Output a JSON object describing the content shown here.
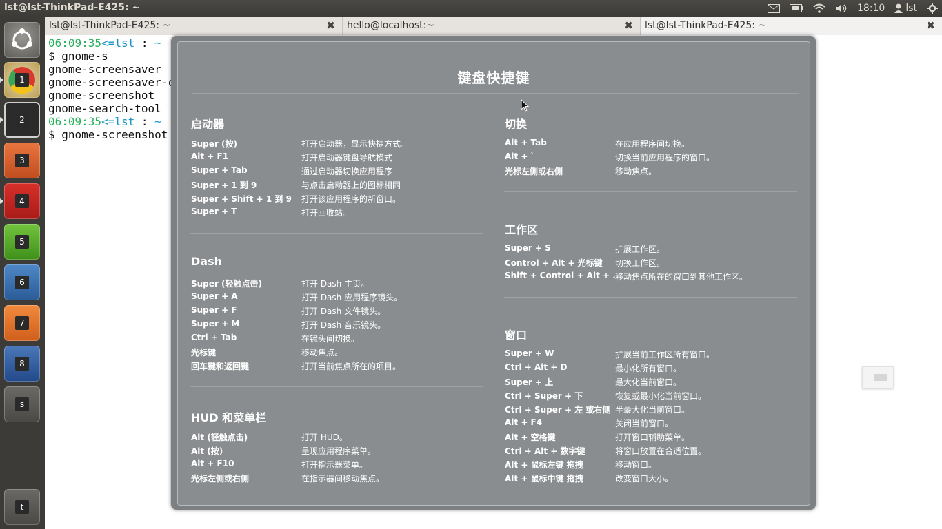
{
  "panel": {
    "title": "lst@lst-ThinkPad-E425: ~",
    "time": "18:10",
    "user": "lst"
  },
  "launcher": {
    "items": [
      {
        "name": "dash-home-icon",
        "number": ""
      },
      {
        "name": "chrome-icon",
        "number": "1"
      },
      {
        "name": "terminal-icon",
        "number": "2"
      },
      {
        "name": "files-icon",
        "number": "3"
      },
      {
        "name": "filezilla-icon",
        "number": "4"
      },
      {
        "name": "app-green-icon",
        "number": "5"
      },
      {
        "name": "thunderbird-icon",
        "number": "6"
      },
      {
        "name": "system-settings-icon",
        "number": "7"
      },
      {
        "name": "virtualbox-icon",
        "number": "8"
      },
      {
        "name": "workspace-switcher-icon",
        "number": "s"
      },
      {
        "name": "trash-icon",
        "number": "t"
      }
    ]
  },
  "tabs": [
    {
      "label": "lst@lst-ThinkPad-E425: ~"
    },
    {
      "label": "hello@localhost:~"
    },
    {
      "label": "lst@lst-ThinkPad-E425: ~"
    }
  ],
  "terminal": {
    "lines": [
      {
        "time": "06:09:35",
        "prompt": "<=lst",
        "sep": " : ",
        "dir": "~"
      },
      {
        "text": "$ gnome-s"
      },
      {
        "text": "gnome-screensaver"
      },
      {
        "text": "gnome-screensaver-command"
      },
      {
        "text": "gnome-screenshot"
      },
      {
        "text": "gnome-search-tool"
      },
      {
        "time": "06:09:35",
        "prompt": "<=lst",
        "sep": " : ",
        "dir": "~"
      },
      {
        "text": "$ gnome-screenshot"
      }
    ]
  },
  "overlay": {
    "title": "键盘快捷键",
    "sections": {
      "launcher": {
        "heading": "启动器",
        "rows": [
          {
            "key": "Super (按)",
            "desc": "打开启动器，显示快捷方式。"
          },
          {
            "key": "Alt + F1",
            "desc": "打开启动器键盘导航模式"
          },
          {
            "key": "Super + Tab",
            "desc": "通过启动器切换应用程序"
          },
          {
            "key": "Super + 1 到 9",
            "desc": "与点击启动器上的图标相同"
          },
          {
            "key": "Super + Shift + 1 到 9",
            "desc": "打开该应用程序的新窗口。"
          },
          {
            "key": "Super + T",
            "desc": "打开回收站。"
          }
        ]
      },
      "dash": {
        "heading": "Dash",
        "rows": [
          {
            "key": "Super (轻触点击)",
            "desc": "打开 Dash 主页。"
          },
          {
            "key": "Super + A",
            "desc": "打开 Dash 应用程序镜头。"
          },
          {
            "key": "Super + F",
            "desc": "打开 Dash 文件镜头。"
          },
          {
            "key": "Super + M",
            "desc": "打开 Dash 音乐镜头。"
          },
          {
            "key": "Ctrl + Tab",
            "desc": "在镜头间切换。"
          },
          {
            "key": "光标键",
            "desc": "移动焦点。"
          },
          {
            "key": "回车键和返回键",
            "desc": "打开当前焦点所在的项目。"
          }
        ]
      },
      "hud": {
        "heading": "HUD 和菜单栏",
        "rows": [
          {
            "key": "Alt (轻触点击)",
            "desc": "打开 HUD。"
          },
          {
            "key": "Alt (按)",
            "desc": "呈现应用程序菜单。"
          },
          {
            "key": "Alt + F10",
            "desc": "打开指示器菜单。"
          },
          {
            "key": "光标左侧或右侧",
            "desc": "在指示器间移动焦点。"
          }
        ]
      },
      "switching": {
        "heading": "切换",
        "rows": [
          {
            "key": "Alt + Tab",
            "desc": "在应用程序间切换。"
          },
          {
            "key": "Alt + `",
            "desc": "切换当前应用程序的窗口。"
          },
          {
            "key": "光标左侧或右侧",
            "desc": "移动焦点。"
          }
        ]
      },
      "workspaces": {
        "heading": "工作区",
        "rows": [
          {
            "key": "Super + S",
            "desc": "扩展工作区。"
          },
          {
            "key": "Control + Alt + 光标键",
            "desc": "切换工作区。"
          },
          {
            "key": "Shift + Control + Alt + ...",
            "desc": "移动焦点所在的窗口到其他工作区。"
          }
        ]
      },
      "windows": {
        "heading": "窗口",
        "rows": [
          {
            "key": "Super + W",
            "desc": "扩展当前工作区所有窗口。"
          },
          {
            "key": "Ctrl + Alt + D",
            "desc": "最小化所有窗口。"
          },
          {
            "key": "Super + 上",
            "desc": "最大化当前窗口。"
          },
          {
            "key": "Ctrl + Super + 下",
            "desc": "恢复或最小化当前窗口。"
          },
          {
            "key": "Ctrl + Super + 左 或右侧",
            "desc": "半最大化当前窗口。"
          },
          {
            "key": "Alt + F4",
            "desc": "关闭当前窗口。"
          },
          {
            "key": "Alt + 空格键",
            "desc": "打开窗口辅助菜单。"
          },
          {
            "key": "Ctrl + Alt + 数字键",
            "desc": "将窗口放置在合适位置。"
          },
          {
            "key": "Alt + 鼠标左键 拖拽",
            "desc": "移动窗口。"
          },
          {
            "key": "Alt + 鼠标中键 拖拽",
            "desc": "改变窗口大小。"
          }
        ]
      }
    }
  }
}
